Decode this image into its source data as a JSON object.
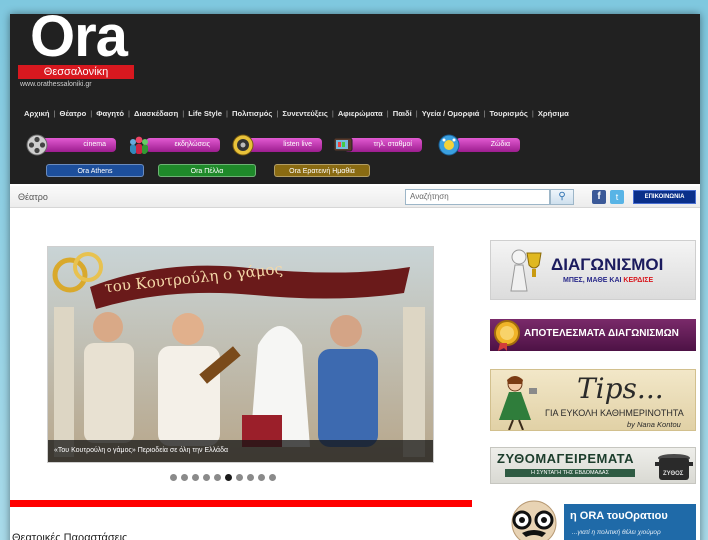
{
  "header": {
    "logo_word": "Ora",
    "logo_city": "Θεσσαλονίκη",
    "logo_url": "www.orathessaloniki.gr"
  },
  "nav": {
    "items": [
      "Αρχική",
      "Θέατρο",
      "Φαγητό",
      "Διασκέδαση",
      "Life Style",
      "Πολιτισμός",
      "Συνεντεύξεις",
      "Αφιερώματα",
      "Παιδί",
      "Υγεία / Ομορφιά",
      "Τουρισμός",
      "Χρήσιμα"
    ]
  },
  "pills": [
    {
      "label": "cinema",
      "icon": "film-reel-icon"
    },
    {
      "label": "εκδηλώσεις",
      "icon": "crowd-icon"
    },
    {
      "label": "listen live",
      "icon": "speaker-icon"
    },
    {
      "label": "τηλ. σταθμοί",
      "icon": "television-icon"
    },
    {
      "label": "Ζώδια",
      "icon": "zodiac-icon"
    }
  ],
  "cities": [
    {
      "label": "Ora Athens",
      "color": "#1d4f9c"
    },
    {
      "label": "Ora Πέλλα",
      "color": "#1f8a2a"
    },
    {
      "label": "Ora Ερατεινή Ημαθία",
      "color": "#8a6b12"
    }
  ],
  "crumb": "Θέατρο",
  "search": {
    "placeholder": "Αναζήτηση"
  },
  "social": {
    "facebook": "f",
    "twitter": "t"
  },
  "contact_label": "ΕΠΙΚΟΙΝΩΝΙΑ",
  "slider": {
    "title_banner": "του Κουτρούλη ο γάμος",
    "caption": "«Του Κουτρούλη ο γάμος» Περιοδεία σε όλη την Ελλάδα",
    "dot_count": 10,
    "active_dot": 6
  },
  "section_title": "Θεατρικές Παραστάσεις",
  "banners": {
    "contests": {
      "title": "ΔΙΑΓΩΝΙΣΜΟΙ",
      "subtitle_a": "ΜΠΕΣ,",
      "subtitle_b": "ΜΑΘΕ ΚΑΙ",
      "subtitle_c": "ΚΕΡΔΙΣΕ"
    },
    "results": {
      "title": "ΑΠΟΤΕΛΕΣΜΑΤΑ ΔΙΑΓΩΝΙΣΜΩΝ"
    },
    "tips": {
      "title": "Tips...",
      "subtitle": "ΓΙΑ ΕΥΚΟΛΗ ΚΑΘΗΜΕΡΙΝΟΤΗΤΑ",
      "author": "by Nana Kontou"
    },
    "recipe": {
      "title": "ΖΥΘΟΜΑΓΕΙΡΕΜΑΤΑ",
      "subtitle": "Η ΣΥΝΤΑΓΗ ΤΗΣ ΕΒΔΟΜΑΔΑΣ",
      "pot_label": "ΖΥΘΟΣ"
    },
    "oratios": {
      "title": "η ORA τουΟρατιου",
      "subtitle": "...γιατί η πολιτική θέλει χιούμορ"
    }
  }
}
